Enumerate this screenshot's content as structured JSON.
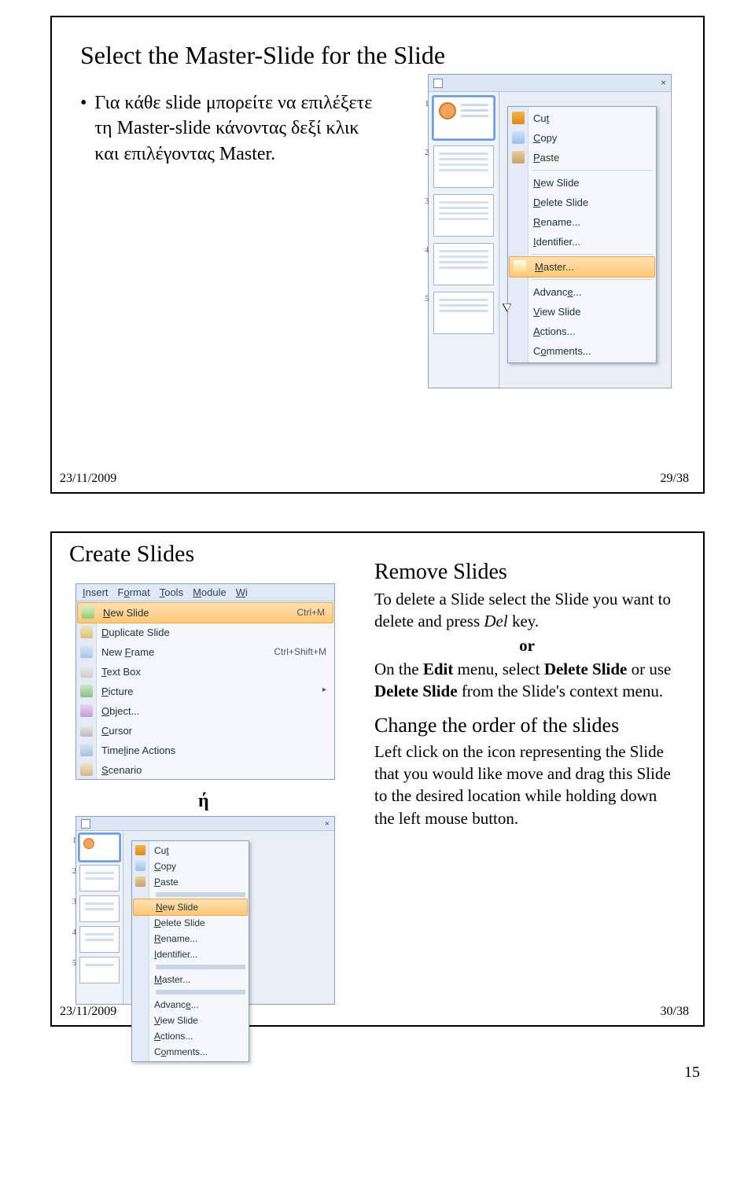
{
  "slide1": {
    "title": "Select the Master-Slide for the Slide",
    "bullet": "Για κάθε slide μπορείτε να επιλέξετε τη Master-slide κάνοντας δεξί κλικ και επιλέγοντας Master.",
    "footer_date": "23/11/2009",
    "footer_page": "29/38",
    "panel": {
      "close": "×",
      "thumb_numbers": [
        "1",
        "2",
        "3",
        "4",
        "5"
      ]
    },
    "context_menu": [
      {
        "label": "Cut",
        "u": "t",
        "icon": "ico-cut"
      },
      {
        "label": "Copy",
        "u": "C",
        "icon": "ico-copy"
      },
      {
        "label": "Paste",
        "u": "P",
        "icon": "ico-paste"
      },
      {
        "sep": true
      },
      {
        "label": "New Slide",
        "u": "N"
      },
      {
        "label": "Delete Slide",
        "u": "D"
      },
      {
        "label": "Rename...",
        "u": "R"
      },
      {
        "label": "Identifier...",
        "u": "I"
      },
      {
        "sep": true
      },
      {
        "label": "Master...",
        "u": "M",
        "icon": "ico-master",
        "highlight": true
      },
      {
        "sep": true
      },
      {
        "label": "Advance...",
        "u": "e"
      },
      {
        "label": "View Slide",
        "u": "V"
      },
      {
        "label": "Actions...",
        "u": "A"
      },
      {
        "label": "Comments...",
        "u": "o"
      }
    ]
  },
  "slide2": {
    "left_title": "Create Slides",
    "eta": "ή",
    "right_title1": "Remove Slides",
    "right_body1a": "To delete a Slide select the Slide you want to delete and press ",
    "right_body1_em": "Del",
    "right_body1b": " key.",
    "right_or": "or",
    "right_body2a": "On the ",
    "right_body2_b1": "Edit",
    "right_body2b": " menu, select ",
    "right_body2_b2": "Delete Slide",
    "right_body2c": " or use ",
    "right_body2_b3": "Delete Slide",
    "right_body2d": " from the Slide's context menu.",
    "right_title2": "Change the order of the slides",
    "right_body3": "Left click on the icon representing the Slide that you would like move and drag this Slide to the desired location while holding down the left mouse button.",
    "footer_date": "23/11/2009",
    "footer_page": "30/38",
    "menubar": [
      "Insert",
      "Format",
      "Tools",
      "Module",
      "Wi"
    ],
    "menubar_u": [
      "I",
      "o",
      "T",
      "M",
      "W"
    ],
    "insert_menu": [
      {
        "label": "New Slide",
        "u": "N",
        "shortcut": "Ctrl+M",
        "icon": "ico-new",
        "highlight": true
      },
      {
        "label": "Duplicate Slide",
        "u": "D",
        "icon": "ico-dup"
      },
      {
        "label": "New Frame",
        "u": "F",
        "shortcut": "Ctrl+Shift+M",
        "icon": "ico-frame"
      },
      {
        "label": "Text Box",
        "u": "T",
        "icon": "ico-tb"
      },
      {
        "label": "Picture",
        "u": "P",
        "icon": "ico-pic",
        "submenu": true
      },
      {
        "label": "Object...",
        "u": "O",
        "icon": "ico-obj"
      },
      {
        "label": "Cursor",
        "u": "C",
        "icon": "ico-cur"
      },
      {
        "label": "Timeline Actions",
        "u": "l",
        "icon": "ico-tl"
      },
      {
        "label": "Scenario",
        "u": "S",
        "icon": "ico-sc"
      }
    ],
    "panel": {
      "close": "×",
      "thumb_numbers": [
        "1",
        "2",
        "3",
        "4",
        "5"
      ]
    },
    "context_menu2": [
      {
        "label": "Cut",
        "u": "t",
        "icon": "ico-cut"
      },
      {
        "label": "Copy",
        "u": "C",
        "icon": "ico-copy"
      },
      {
        "label": "Paste",
        "u": "P",
        "icon": "ico-paste"
      },
      {
        "sep": true
      },
      {
        "label": "New Slide",
        "u": "N",
        "highlight": true
      },
      {
        "label": "Delete Slide",
        "u": "D"
      },
      {
        "label": "Rename...",
        "u": "R"
      },
      {
        "label": "Identifier...",
        "u": "I"
      },
      {
        "sep": true
      },
      {
        "label": "Master...",
        "u": "M"
      },
      {
        "sep": true
      },
      {
        "label": "Advance...",
        "u": "e"
      },
      {
        "label": "View Slide",
        "u": "V"
      },
      {
        "label": "Actions...",
        "u": "A"
      },
      {
        "label": "Comments...",
        "u": "o"
      }
    ]
  },
  "page_number": "15"
}
